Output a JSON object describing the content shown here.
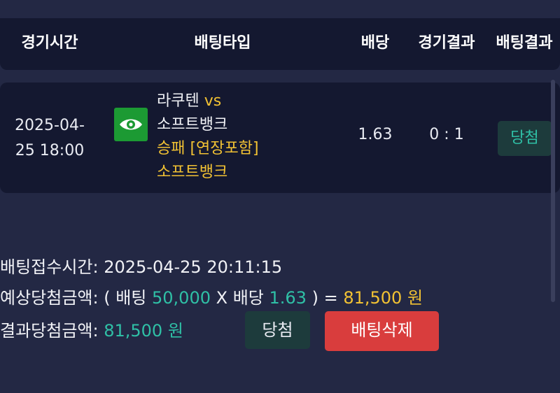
{
  "header": {
    "col_time": "경기시간",
    "col_type": "배팅타입",
    "col_odds": "배당",
    "col_game_result": "경기결과",
    "col_bet_result": "배팅결과"
  },
  "bet_row": {
    "time_line1": "2025-04-",
    "time_line2": "25 18:00",
    "icon": "eye-icon",
    "home_team": "라쿠텐",
    "vs": "vs",
    "away_team": "소프트뱅크",
    "market": "승패 [연장포함]",
    "pick": "소프트뱅크",
    "odds": "1.63",
    "score": "0 : 1",
    "result": "당첨"
  },
  "info": {
    "received_label": "배팅접수시간:",
    "received_value": "2025-04-25 20:11:15",
    "expected_label": "예상당첨금액:",
    "expected_open": "( 배팅",
    "bet_amount": "50,000",
    "times": "X 배당",
    "odds_value": "1.63",
    "close_eq": ") =",
    "expected_amount": "81,500 원",
    "result_label": "결과당첨금액:",
    "result_amount": "81,500 원"
  },
  "buttons": {
    "win_label": "당첨",
    "delete_label": "배팅삭제"
  },
  "colors": {
    "background": "#232844",
    "panel": "#141830",
    "teal": "#2fc0a6",
    "gold": "#f2c233",
    "danger": "#d93d3d",
    "icon_green": "#1c9a33"
  }
}
